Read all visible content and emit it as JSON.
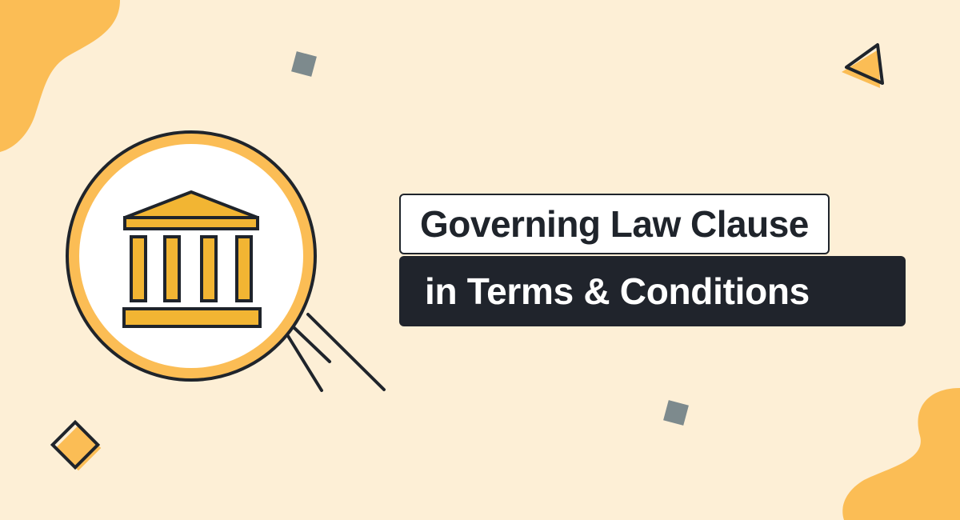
{
  "banner": {
    "title_line1": "Governing Law Clause",
    "title_line2": "in Terms & Conditions"
  },
  "icons": {
    "main": "courthouse-in-magnifier-icon",
    "decorations": [
      "diamond-icon",
      "triangle-play-icon",
      "diamond-outline-icon"
    ]
  },
  "colors": {
    "background": "#fdefd6",
    "accent_orange": "#fbbd55",
    "pillar_yellow": "#f2b533",
    "dark": "#20242c",
    "gray_square": "#7d8a8d"
  }
}
